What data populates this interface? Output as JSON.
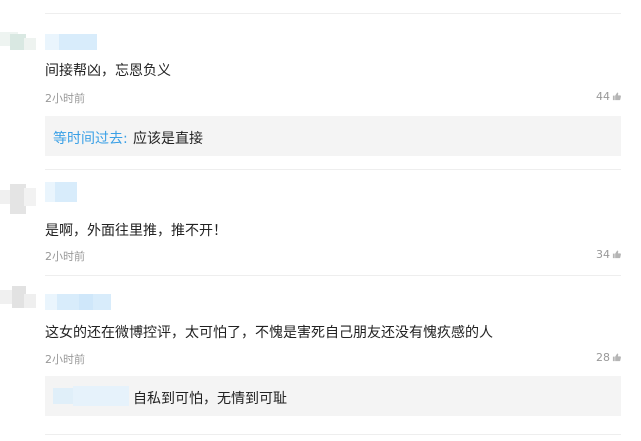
{
  "comments": [
    {
      "text": "间接帮凶，忘恩负义",
      "time": "2小时前",
      "likes": "44",
      "reply": {
        "author": "等时间过去:",
        "text": "应该是直接"
      }
    },
    {
      "text": "是啊，外面往里推，推不开！",
      "time": "2小时前",
      "likes": "34"
    },
    {
      "text": "这女的还在微博控评，太可怕了，不愧是害死自己朋友还没有愧疚感的人",
      "time": "2小时前",
      "likes": "28",
      "reply": {
        "author": "",
        "text": "自私到可怕，无情到可耻"
      }
    }
  ],
  "colors": {
    "link": "#3aa0e6",
    "reply_bg": "#f4f4f4",
    "meta": "#999999"
  },
  "icons": {
    "like": "thumbs-up-icon"
  }
}
